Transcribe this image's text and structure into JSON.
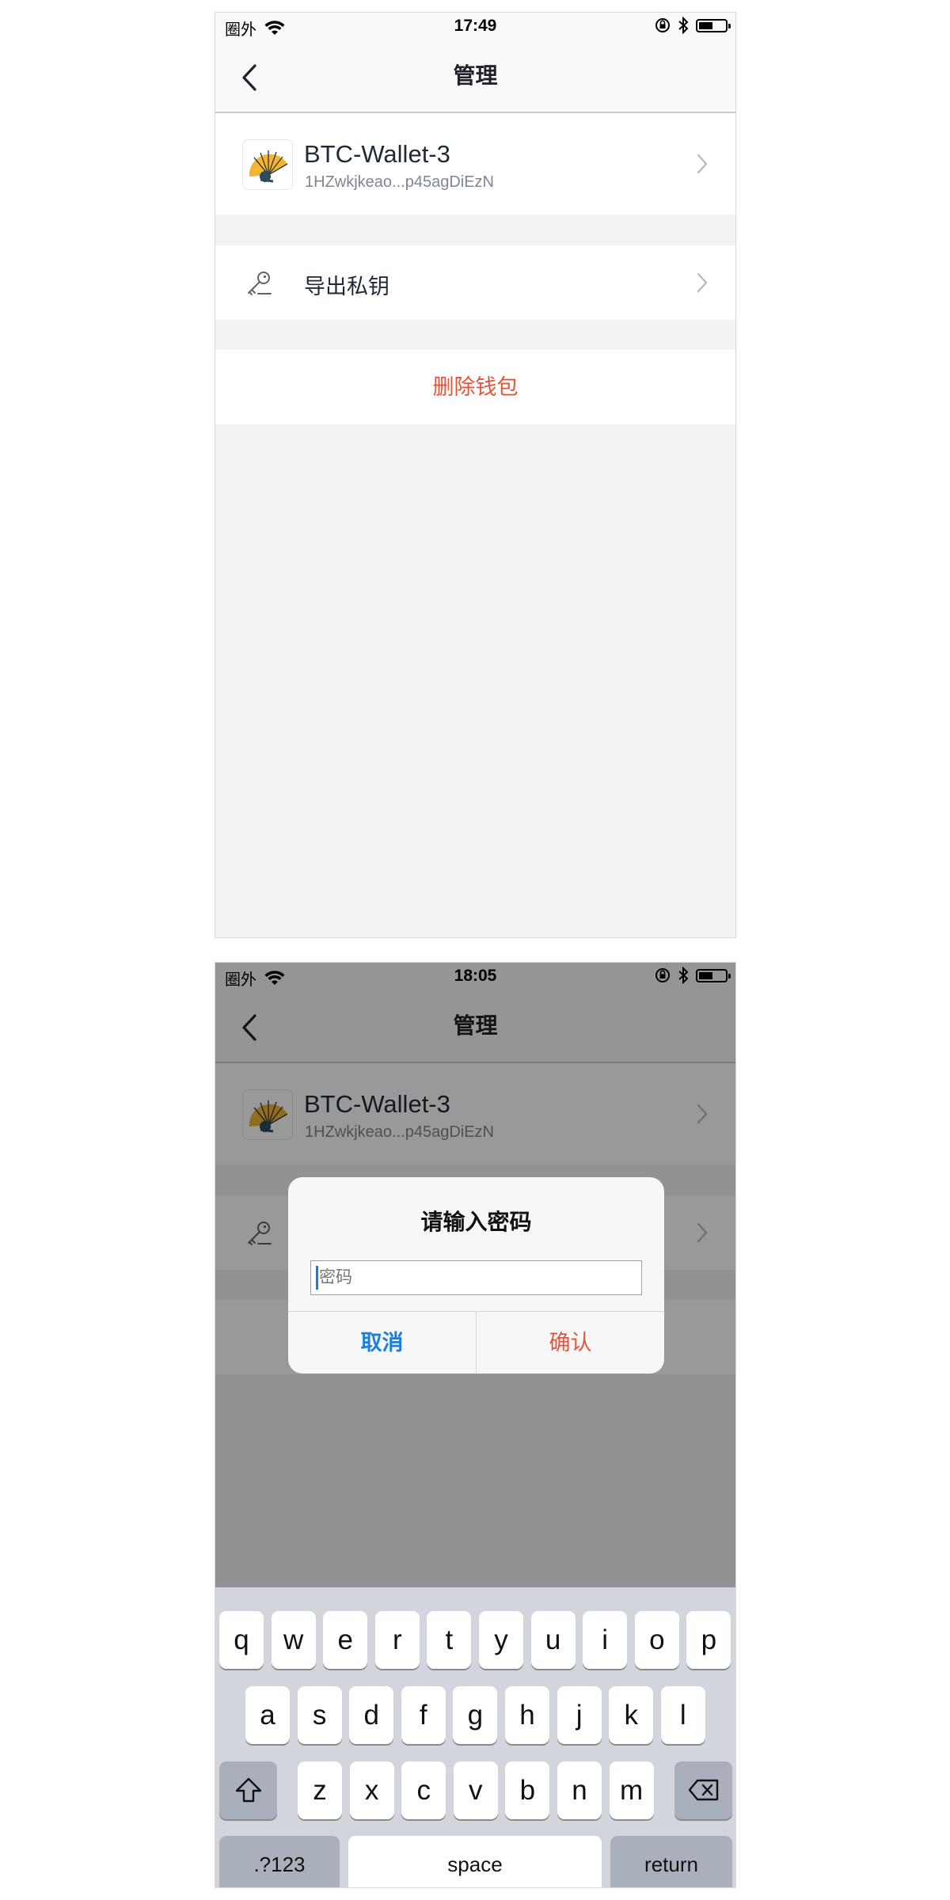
{
  "screen1": {
    "status": {
      "carrier": "圈外",
      "time": "17:49"
    },
    "nav": {
      "title": "管理"
    },
    "wallet": {
      "name": "BTC-Wallet-3",
      "address": "1HZwkjkeao...p45agDiEzN"
    },
    "export_label": "导出私钥",
    "delete_label": "删除钱包"
  },
  "screen2": {
    "status": {
      "carrier": "圈外",
      "time": "18:05"
    },
    "nav": {
      "title": "管理"
    },
    "wallet": {
      "name": "BTC-Wallet-3",
      "address": "1HZwkjkeao...p45agDiEzN"
    },
    "dialog": {
      "title": "请输入密码",
      "placeholder": "密码",
      "cancel": "取消",
      "confirm": "确认"
    },
    "keyboard": {
      "row1": [
        "q",
        "w",
        "e",
        "r",
        "t",
        "y",
        "u",
        "i",
        "o",
        "p"
      ],
      "row2": [
        "a",
        "s",
        "d",
        "f",
        "g",
        "h",
        "j",
        "k",
        "l"
      ],
      "row3": [
        "z",
        "x",
        "c",
        "v",
        "b",
        "n",
        "m"
      ],
      "numbers": ".?123",
      "space": "space",
      "return": "return"
    }
  },
  "icons": {
    "wifi": "wifi-icon",
    "rotation_lock": "rotation-lock-icon",
    "bluetooth": "bluetooth-icon",
    "battery": "battery-icon",
    "back": "chevron-left-icon",
    "chevron": "chevron-right-icon",
    "key": "key-icon",
    "shift": "shift-icon",
    "backspace": "backspace-icon"
  },
  "colors": {
    "danger": "#e2553c",
    "link": "#1a7fe0",
    "background": "#f2f3f5"
  }
}
